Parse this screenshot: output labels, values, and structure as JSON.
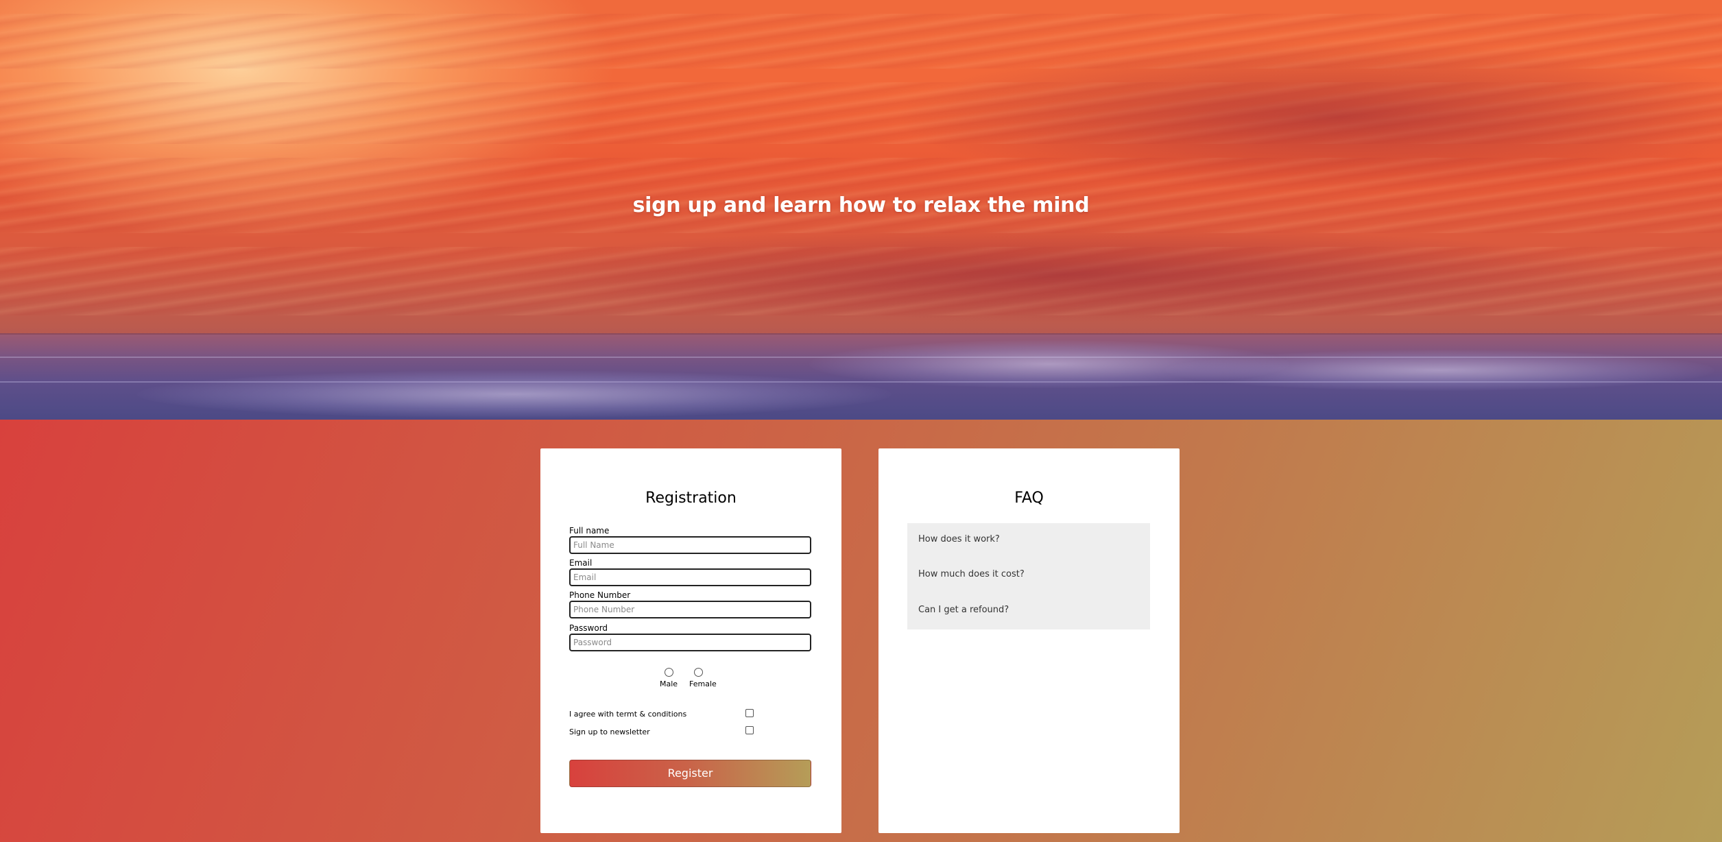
{
  "hero": {
    "title": "sign up and learn how to relax the mind"
  },
  "registration": {
    "title": "Registration",
    "fields": [
      {
        "label": "Full name",
        "placeholder": "Full Name",
        "value": ""
      },
      {
        "label": "Email",
        "placeholder": "Email",
        "value": ""
      },
      {
        "label": "Phone Number",
        "placeholder": "Phone Number",
        "value": ""
      },
      {
        "label": "Password",
        "placeholder": "Password",
        "value": ""
      }
    ],
    "gender": {
      "options": [
        "Male",
        "Female"
      ],
      "selected": null
    },
    "checkboxes": [
      {
        "label": "I agree with termt & conditions",
        "checked": false
      },
      {
        "label": "Sign up to newsletter",
        "checked": false
      }
    ],
    "submit_label": "Register"
  },
  "faq": {
    "title": "FAQ",
    "items": [
      "How does it work?",
      "How much does it cost?",
      "Can I get a refound?"
    ]
  },
  "colors": {
    "gradient_start": "#d8413d",
    "gradient_end": "#b59d58",
    "card_background": "#ffffff",
    "faq_background": "#eeeeee"
  }
}
